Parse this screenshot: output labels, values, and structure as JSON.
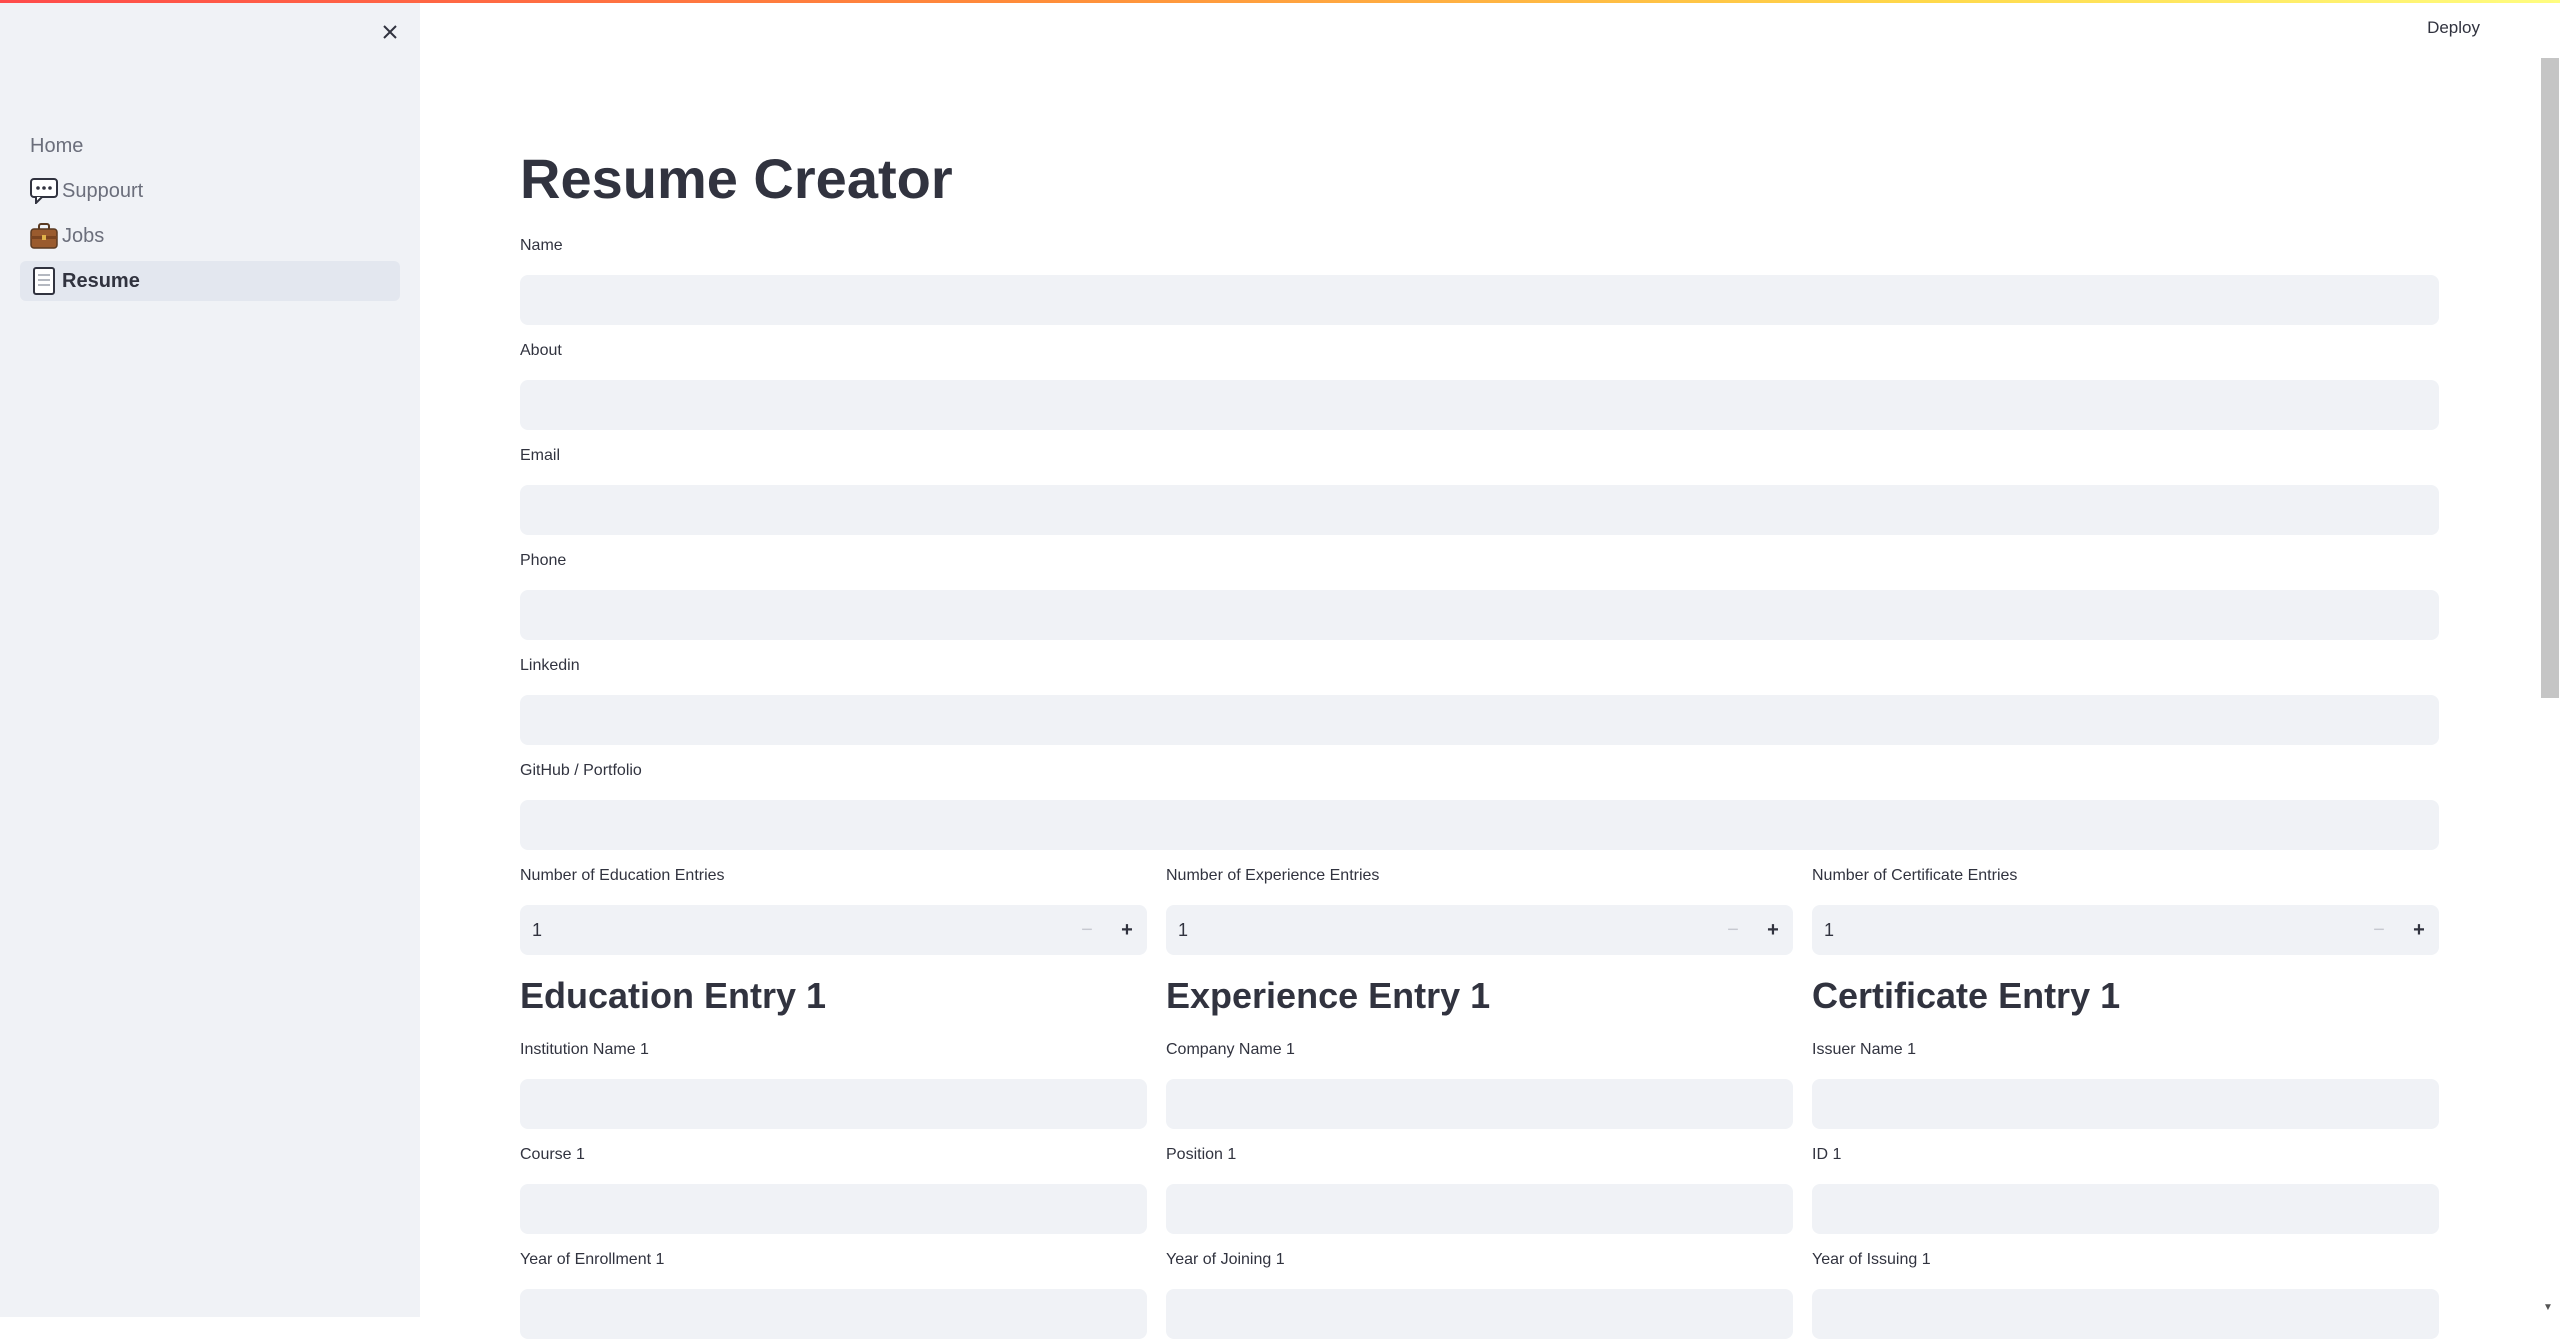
{
  "sidebar": {
    "items": [
      {
        "label": "Home",
        "icon": ""
      },
      {
        "label": "Suppourt",
        "icon": "speech-bubble-icon"
      },
      {
        "label": "Jobs",
        "icon": "briefcase-icon"
      },
      {
        "label": "Resume",
        "icon": "page-icon",
        "active": true
      }
    ]
  },
  "header": {
    "deploy_label": "Deploy"
  },
  "page": {
    "title": "Resume Creator"
  },
  "fields": {
    "name": {
      "label": "Name",
      "value": ""
    },
    "about": {
      "label": "About",
      "value": ""
    },
    "email": {
      "label": "Email",
      "value": ""
    },
    "phone": {
      "label": "Phone",
      "value": ""
    },
    "linkedin": {
      "label": "Linkedin",
      "value": ""
    },
    "github": {
      "label": "GitHub / Portfolio",
      "value": ""
    }
  },
  "counts": {
    "education": {
      "label": "Number of Education Entries",
      "value": "1"
    },
    "experience": {
      "label": "Number of Experience Entries",
      "value": "1"
    },
    "certificate": {
      "label": "Number of Certificate Entries",
      "value": "1"
    }
  },
  "sections": {
    "education": {
      "heading": "Education Entry 1",
      "field1": "Institution Name 1",
      "field2": "Course 1",
      "field3": "Year of Enrollment 1"
    },
    "experience": {
      "heading": "Experience Entry 1",
      "field1": "Company Name 1",
      "field2": "Position 1",
      "field3": "Year of Joining 1"
    },
    "certificate": {
      "heading": "Certificate Entry 1",
      "field1": "Issuer Name 1",
      "field2": "ID 1",
      "field3": "Year of Issuing 1"
    }
  },
  "colors": {
    "accent": "#ff4b4b",
    "sidebar_bg": "#f0f2f6",
    "input_bg": "#f0f2f6",
    "text": "#31333f"
  }
}
